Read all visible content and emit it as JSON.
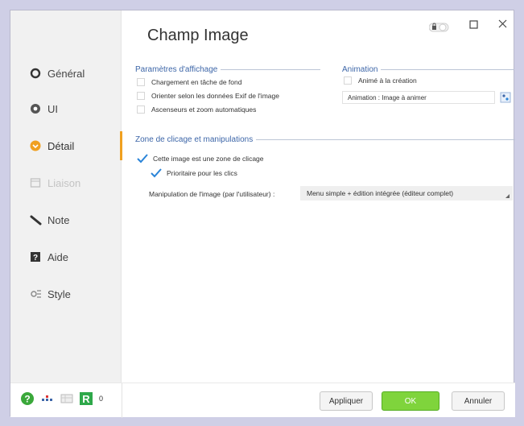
{
  "window": {
    "title": "Champ Image"
  },
  "sidebar": {
    "items": [
      {
        "label": "Général",
        "icon": "circle-icon"
      },
      {
        "label": "UI",
        "icon": "eye-icon"
      },
      {
        "label": "Détail",
        "icon": "detail-circle-icon",
        "active": true
      },
      {
        "label": "Liaison",
        "icon": "link-box-icon",
        "disabled": true
      },
      {
        "label": "Note",
        "icon": "pencil-icon"
      },
      {
        "label": "Aide",
        "icon": "help-box-icon"
      },
      {
        "label": "Style",
        "icon": "style-icon"
      }
    ]
  },
  "display_params": {
    "title": "Paramètres d'affichage",
    "options": [
      {
        "label": "Chargement en tâche de fond",
        "checked": false
      },
      {
        "label": "Orienter selon les données Exif de l'image",
        "checked": false
      },
      {
        "label": "Ascenseurs et zoom automatiques",
        "checked": false
      }
    ]
  },
  "animation": {
    "title": "Animation",
    "option_label": "Animé à la création",
    "option_checked": false,
    "select_value": "Animation : Image à animer"
  },
  "click_zone": {
    "title": "Zone de clicage et manipulations",
    "zone_label": "Cette image est une zone de clicage",
    "priority_label": "Prioritaire pour les clics",
    "manip_label": "Manipulation de l'image (par l'utilisateur) :",
    "manip_value": "Menu simple + édition intégrée (éditeur complet)"
  },
  "bottom": {
    "counter": "0",
    "apply_label": "Appliquer",
    "ok_label": "OK",
    "cancel_label": "Annuler"
  },
  "colors": {
    "accent_active": "#f0a020",
    "header_blue": "#3d66a8",
    "check_blue": "#2a84d8",
    "ok_green": "#7fd43c"
  }
}
